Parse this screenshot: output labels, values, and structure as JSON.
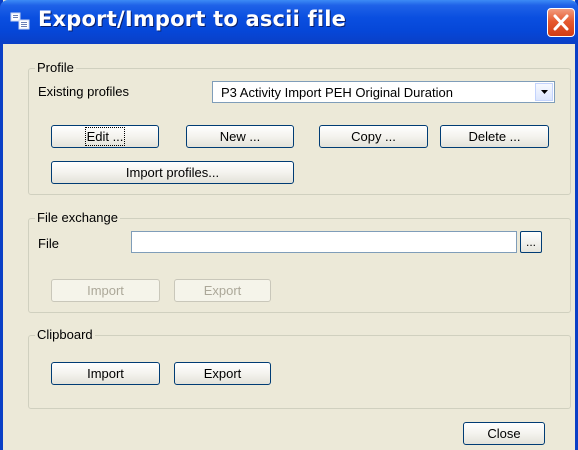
{
  "window": {
    "title": "Export/Import to ascii file",
    "close_symbol": "✕"
  },
  "profile": {
    "legend": "Profile",
    "existing_label": "Existing profiles",
    "selected_profile": "P3 Activity Import PEH Original Duration",
    "edit_label": "Edit ...",
    "new_label": "New ...",
    "copy_label": "Copy ...",
    "delete_label": "Delete ...",
    "import_profiles_label": "Import profiles..."
  },
  "file_exchange": {
    "legend": "File exchange",
    "file_label": "File",
    "file_value": "",
    "browse_label": "...",
    "import_label": "Import",
    "export_label": "Export"
  },
  "clipboard": {
    "legend": "Clipboard",
    "import_label": "Import",
    "export_label": "Export"
  },
  "footer": {
    "close_label": "Close"
  },
  "colors": {
    "titlebar": "#0a4fe0",
    "dialog_bg": "#ece9d8",
    "close_button": "#e65a30"
  }
}
